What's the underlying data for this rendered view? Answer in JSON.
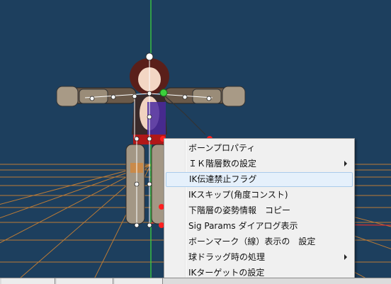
{
  "viewport": {
    "grid_color": "#e08a2c",
    "axis_y_color": "#3cd03c",
    "axis_x_color": "#d83030",
    "bone_color": "#ffffff",
    "selected_bone_color": "#ff2020"
  },
  "context_menu": {
    "items": [
      {
        "label": "ボーンプロパティ",
        "has_submenu": false,
        "highlighted": false
      },
      {
        "label": "ＩＫ階層数の設定",
        "has_submenu": true,
        "highlighted": false
      },
      {
        "label": "IK伝達禁止フラグ",
        "has_submenu": false,
        "highlighted": true
      },
      {
        "label": "IKスキップ(角度コンスト)",
        "has_submenu": false,
        "highlighted": false
      },
      {
        "label": "下階層の姿勢情報　コピー",
        "has_submenu": false,
        "highlighted": false
      },
      {
        "label": "Sig Params ダイアログ表示",
        "has_submenu": false,
        "highlighted": false
      },
      {
        "label": "ボーンマーク（線）表示の　設定",
        "has_submenu": false,
        "highlighted": false
      },
      {
        "label": "球ドラッグ時の処理",
        "has_submenu": true,
        "highlighted": false
      },
      {
        "label": "IKターゲットの設定",
        "has_submenu": false,
        "highlighted": false
      }
    ]
  }
}
